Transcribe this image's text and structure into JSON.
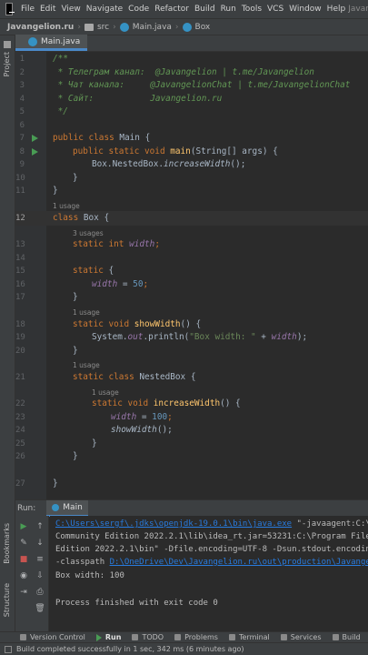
{
  "menubar": {
    "items": [
      "File",
      "Edit",
      "View",
      "Navigate",
      "Code",
      "Refactor",
      "Build",
      "Run",
      "Tools",
      "VCS",
      "Window",
      "Help"
    ],
    "project_title": "Javangel"
  },
  "breadcrumb": {
    "project": "Javangelion.ru",
    "folder": "src",
    "file": "Main.java",
    "cls": "Box"
  },
  "editor_tab": {
    "label": "Main.java"
  },
  "left_strip": {
    "project": "Project",
    "bookmarks": "Bookmarks",
    "structure": "Structure"
  },
  "gutter": {
    "lines": [
      "1",
      "2",
      "3",
      "4",
      "5",
      "6",
      "7",
      "8",
      "9",
      "10",
      "11",
      "12",
      "13",
      "14",
      "15",
      "16",
      "17",
      "18",
      "19",
      "20",
      "21",
      "22",
      "23",
      "24",
      "25",
      "26",
      "27"
    ]
  },
  "code": {
    "l1": "/**",
    "l2a": " * Телеграм канал:  ",
    "l2b": "@Javangelion | t.me/Javangelion",
    "l3a": " * Чат канала:     ",
    "l3b": "@JavangelionChat | t.me/JavangelionChat",
    "l4a": " * Сайт:           ",
    "l4b": "Javangelion.ru",
    "l5": " */",
    "l7_kw1": "public class ",
    "l7_name": "Main {",
    "l8_kw": "public static void ",
    "l8_fn": "main",
    "l8_rest": "(String[] args) {",
    "l9_a": "Box.NestedBox.",
    "l9_b": "increaseWidth",
    "l9_c": "();",
    "l10": "}",
    "l11": "}",
    "u12": "1 usage",
    "l12_kw": "class ",
    "l12_name": "Box {",
    "u13": "3 usages",
    "l13_kw": "static int ",
    "l13_fld": "width",
    "l13_end": ";",
    "l15_kw": "static ",
    "l15_end": "{",
    "l16_fld": "width",
    "l16_mid": " = ",
    "l16_num": "50",
    "l16_end": ";",
    "l17": "}",
    "u18": "1 usage",
    "l18_kw": "static void ",
    "l18_fn": "showWidth",
    "l18_end": "() {",
    "l19_a": "System.",
    "l19_out": "out",
    "l19_b": ".println(",
    "l19_str": "\"Box width: \"",
    "l19_c": " + ",
    "l19_fld": "width",
    "l19_d": ");",
    "l20": "}",
    "u21": "1 usage",
    "l21_kw": "static class ",
    "l21_name": "NestedBox {",
    "u22": "1 usage",
    "l22_kw": "static void ",
    "l22_fn": "increaseWidth",
    "l22_end": "() {",
    "l23_fld": "width",
    "l23_mid": " = ",
    "l23_num": "100",
    "l23_end": ";",
    "l24_fn": "showWidth",
    "l24_end": "();",
    "l25": "}",
    "l26": "}",
    "l27": "}"
  },
  "run_panel": {
    "label": "Run:",
    "tab": "Main",
    "console": {
      "line1_link": "C:\\Users\\sergf\\.jdks\\openjdk-19.0.1\\bin\\java.exe",
      "line1_rest": " \"-javaagent:C:\\P",
      "line2": "Community Edition 2022.2.1\\lib\\idea_rt.jar=53231:C:\\Program File",
      "line3": "Edition 2022.2.1\\bin\" -Dfile.encoding=UTF-8 -Dsun.stdout.encodin",
      "line4_a": "-classpath ",
      "line4_link": "D:\\OneDrive\\Dev\\Javangelion.ru\\out\\production\\Javange",
      "line5": "Box width: 100",
      "line6": "Process finished with exit code 0"
    }
  },
  "bottom_tools": [
    "Version Control",
    "Run",
    "TODO",
    "Problems",
    "Terminal",
    "Services",
    "Build"
  ],
  "status": {
    "text": "Build completed successfully in 1 sec, 342 ms (6 minutes ago)"
  },
  "colors": {
    "keyword": "#cc7832",
    "method": "#ffc66d",
    "field": "#9876aa",
    "number": "#6897bb",
    "string": "#6a8759",
    "comment": "#629755",
    "link": "#287bde"
  }
}
